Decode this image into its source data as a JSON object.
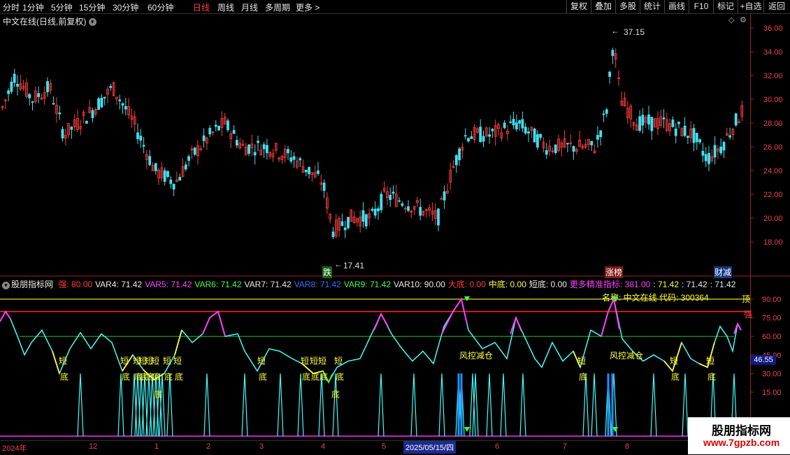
{
  "toolbar": {
    "tabs": [
      "分时",
      "1分钟",
      "5分钟",
      "15分钟",
      "30分钟",
      "60分钟",
      "日线",
      "周线",
      "月线",
      "多周期",
      "更多 >"
    ],
    "active_tab": "日线",
    "buttons": [
      "复权",
      "叠加",
      "多股",
      "统计",
      "画线",
      "F10",
      "标记",
      "+自选",
      "返回"
    ]
  },
  "main": {
    "title": "中文在线(日线,前复权)",
    "high_label": "37.15",
    "low_label": "17.41",
    "events": [
      "跌",
      "涨榜",
      "财减"
    ],
    "y_ticks": [
      "36.00",
      "34.00",
      "32.00",
      "30.00",
      "28.00",
      "26.00",
      "24.00",
      "22.00",
      "20.00",
      "18.00"
    ]
  },
  "indicator": {
    "name": "股朋指标网",
    "legend": [
      {
        "text": "强: 80.00",
        "color": "#ff3c3c"
      },
      {
        "text": "VAR4: 71.42",
        "color": "#e8e8e8"
      },
      {
        "text": "VAR5: 71.42",
        "color": "#ff40ff"
      },
      {
        "text": "VAR6: 71.42",
        "color": "#40ff40"
      },
      {
        "text": "VAR7: 71.42",
        "color": "#e8e8e8"
      },
      {
        "text": "VAR8: 71.42",
        "color": "#3c6cff"
      },
      {
        "text": "VAR9: 71.42",
        "color": "#40ff40"
      },
      {
        "text": "VAR10: 90.00",
        "color": "#e8e8e8"
      },
      {
        "text": "大底: 0.00",
        "color": "#ff3c3c"
      },
      {
        "text": "中底: 0.00",
        "color": "#ffff3c"
      },
      {
        "text": "短底: 0.00",
        "color": "#e8e8e8"
      },
      {
        "text": "更多精准指标: 381.00",
        "color": "#ff40ff"
      },
      {
        "text": ": 71.42",
        "color": "#ffff3c"
      },
      {
        "text": ": 71.42",
        "color": "#e8e8e8"
      },
      {
        "text": ": 71.42",
        "color": "#e8e8e8"
      }
    ],
    "name_code": "名称: 中文在线 代码: 300364",
    "top_label": "顶",
    "strong_label": "强",
    "y_ticks": [
      "90.00",
      "75.00",
      "60.00",
      "45.00",
      "30.00",
      "15.00"
    ],
    "current_value": "46.55",
    "signal_short": "短",
    "signal_bottom": "底",
    "signal_wind": "风控减仓"
  },
  "dates": {
    "labels": [
      "2024年",
      "12",
      "1",
      "2",
      "3",
      "4",
      "5",
      "6",
      "7",
      "8",
      "9"
    ],
    "cursor": "2025/05/15/四"
  },
  "watermark": {
    "name": "股朋指标网",
    "url": "www.7gpzb.com"
  }
}
